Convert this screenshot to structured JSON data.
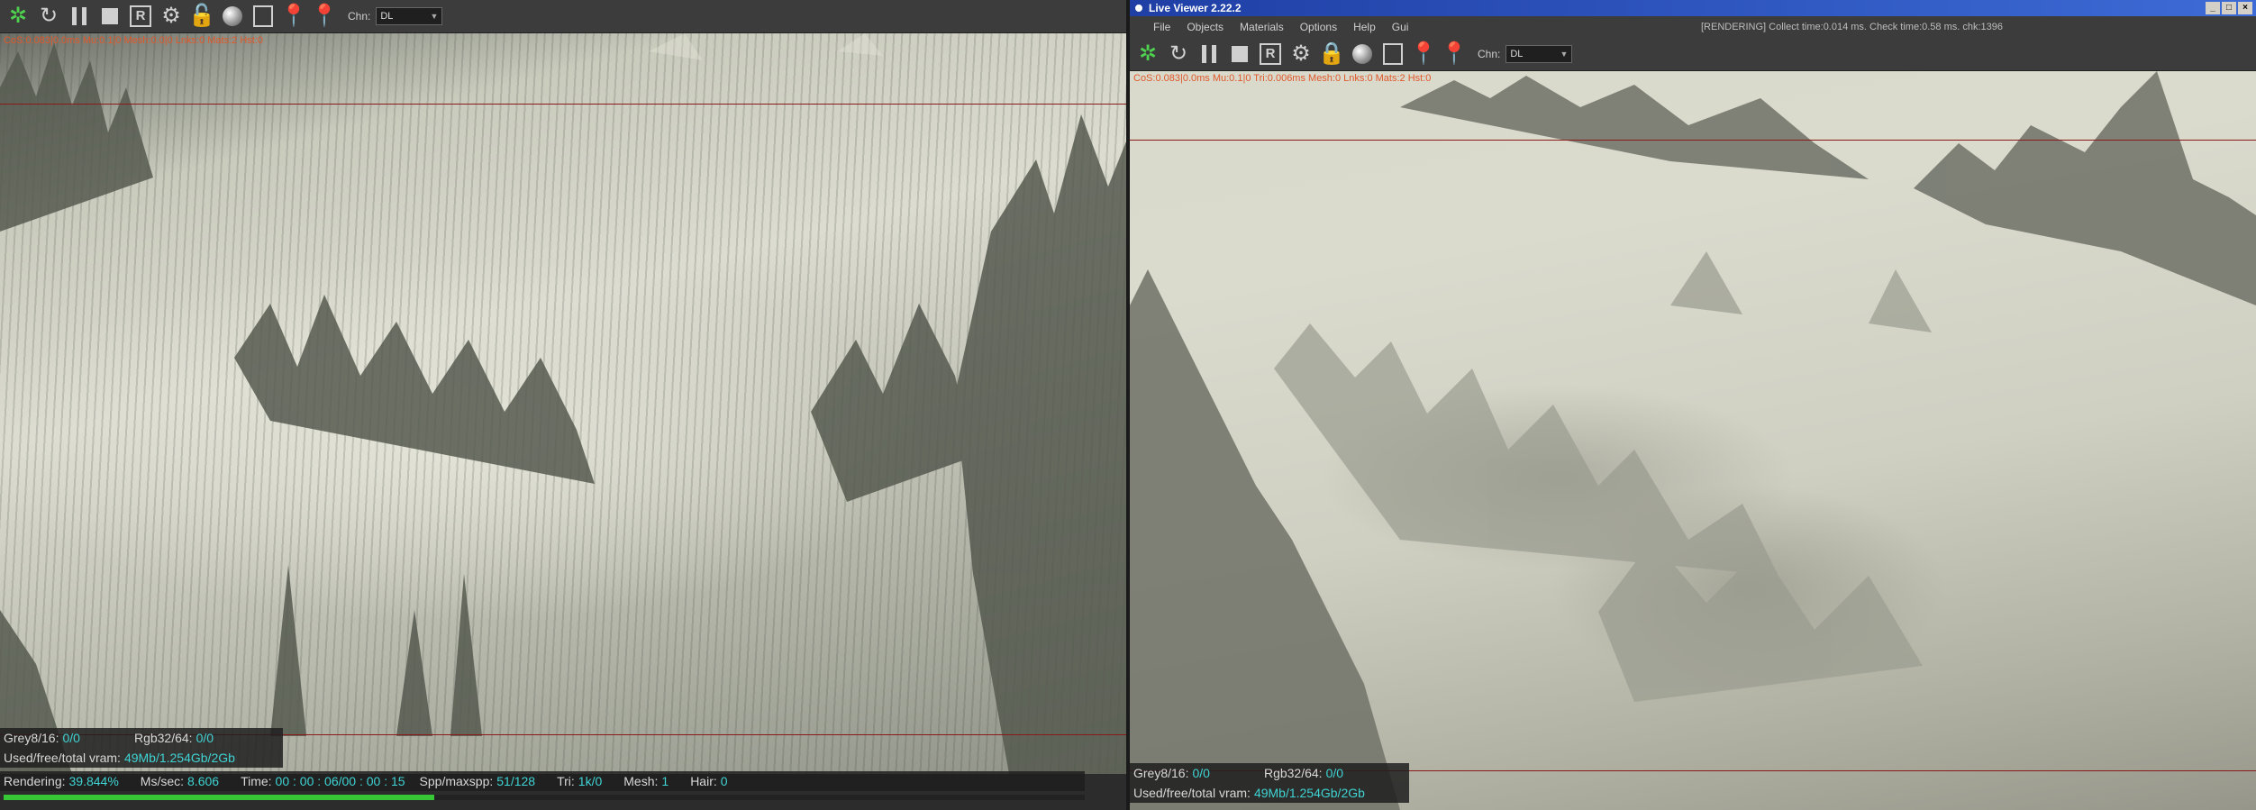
{
  "left": {
    "toolbar": {
      "chn_label": "Chn:",
      "chn_value": "DL"
    },
    "info_line": "CoS:0.083|0.0ms  Mu:0.1|0  Mesh:0.0|0  Lnks:0  Mats:2  Hst:0",
    "stats": {
      "grey_label": "Grey8/16:",
      "grey_value": "0/0",
      "rgb_label": "Rgb32/64:",
      "rgb_value": "0/0",
      "vram_label": "Used/free/total vram:",
      "vram_value": "49Mb/1.254Gb/2Gb",
      "rendering_label": "Rendering:",
      "rendering_value": "39.844%",
      "mssec_label": "Ms/sec:",
      "mssec_value": "8.606",
      "time_label": "Time:",
      "time_value": "00 : 00 : 06/00 : 00 : 15",
      "spp_label": "Spp/maxspp:",
      "spp_value": "51/128",
      "tri_label": "Tri:",
      "tri_value": "1k/0",
      "mesh_label": "Mesh:",
      "mesh_value": "1",
      "hair_label": "Hair:",
      "hair_value": "0"
    },
    "progress": 0.39844
  },
  "right": {
    "title": "Live Viewer 2.22.2",
    "menu": [
      "File",
      "Objects",
      "Materials",
      "Options",
      "Help",
      "Gui"
    ],
    "menu_status": "[RENDERING] Collect time:0.014 ms.  Check time:0.58 ms.  chk:1396",
    "toolbar": {
      "chn_label": "Chn:",
      "chn_value": "DL"
    },
    "info_line": "CoS:0.083|0.0ms  Mu:0.1|0  Tri:0.006ms  Mesh:0  Lnks:0  Mats:2  Hst:0",
    "stats": {
      "grey_label": "Grey8/16:",
      "grey_value": "0/0",
      "rgb_label": "Rgb32/64:",
      "rgb_value": "0/0",
      "vram_label": "Used/free/total vram:",
      "vram_value": "49Mb/1.254Gb/2Gb"
    }
  },
  "icons": [
    "octane-logo-icon",
    "refresh-icon",
    "pause-icon",
    "stop-icon",
    "region-render-icon",
    "settings-gear-icon",
    "lock-icon",
    "material-ball-icon",
    "frame-icon",
    "pick-focus-icon",
    "pick-material-icon"
  ],
  "colors": {
    "stat_value": "#3fd3d3",
    "progress": "#36c636",
    "info_text": "#e0582a"
  }
}
